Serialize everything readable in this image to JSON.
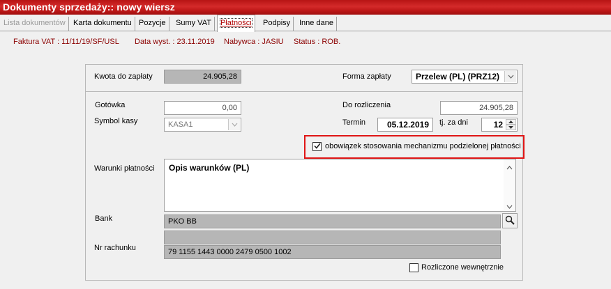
{
  "window": {
    "title": "Dokumenty sprzedaży:: nowy wiersz"
  },
  "tabs": [
    {
      "label": "Lista dokumentów",
      "state": "disabled"
    },
    {
      "label": "Karta dokumentu",
      "state": "normal"
    },
    {
      "label": "Pozycje",
      "state": "normal"
    },
    {
      "label": "Sumy VAT",
      "state": "normal"
    },
    {
      "label": "Płatności",
      "state": "active"
    },
    {
      "label": "Podpisy",
      "state": "normal"
    },
    {
      "label": "Inne dane",
      "state": "normal"
    }
  ],
  "info": {
    "invoice": "Faktura VAT : 11/11/19/SF/USL",
    "date": "Data wyst. : 23.11.2019",
    "buyer": "Nabywca : JASIU",
    "status": "Status : ROB."
  },
  "payment": {
    "amount_label": "Kwota do zapłaty",
    "amount_value": "24.905,28",
    "form_label": "Forma zapłaty",
    "form_value": "Przelew (PL)  (PRZ12)",
    "cash_label": "Gotówka",
    "cash_value": "0,00",
    "cashbox_label": "Symbol kasy",
    "cashbox_value": "KASA1",
    "settle_label": "Do rozliczenia",
    "settle_value": "24.905,28",
    "term_label": "Termin",
    "term_value": "05.12.2019",
    "days_label": "tj. za dni",
    "days_value": "12",
    "split_label": "obowiązek stosowania mechanizmu podzielonej płatności",
    "split_checked": true,
    "terms_label": "Warunki płatności",
    "terms_value": "Opis warunków (PL)",
    "bank_label": "Bank",
    "bank_value": "PKO BB",
    "account_label": "Nr rachunku",
    "account_value": "79 1155 1443 0000 2479 0500 1002",
    "internal_label": "Rozliczone wewnętrznie",
    "internal_checked": false
  },
  "colors": {
    "title_bar": "#c01818",
    "info_text": "#8b0000",
    "highlight": "#e01515"
  },
  "icons": [
    "dropdown-arrow-icon",
    "spin-up-icon",
    "spin-down-icon",
    "checkmark-icon",
    "scroll-up-icon",
    "scroll-down-icon",
    "magnifier-icon"
  ]
}
